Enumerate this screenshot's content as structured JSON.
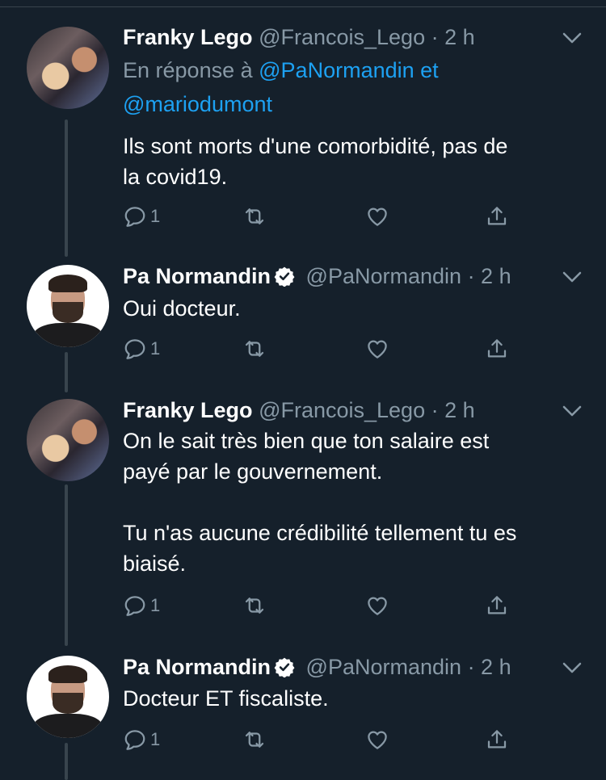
{
  "tweets": [
    {
      "name": "Franky Lego",
      "handle": "@Francois_Lego",
      "time": "· 2 h",
      "reply_prefix": "En réponse à",
      "reply_users": [
        "@PaNormandin",
        "@mariodumont"
      ],
      "reply_joiner": "et",
      "text_lines": [
        "Ils sont morts d'une comorbidité, pas de",
        "la covid19."
      ],
      "reply_count": "1",
      "verified": false,
      "avatar": "franky-lego-avatar"
    },
    {
      "name": "Pa Normandin",
      "handle": "@PaNormandin",
      "time": "· 2 h",
      "text_lines": [
        "Oui docteur."
      ],
      "reply_count": "1",
      "verified": true,
      "avatar": "pa-normandin-avatar"
    },
    {
      "name": "Franky Lego",
      "handle": "@Francois_Lego",
      "time": "· 2 h",
      "text_lines": [
        "On le sait très bien que ton salaire est",
        "payé par le gouvernement.",
        "",
        "Tu n'as aucune crédibilité tellement tu es",
        "biaisé."
      ],
      "reply_count": "1",
      "verified": false,
      "avatar": "franky-lego-avatar"
    },
    {
      "name": "Pa Normandin",
      "handle": "@PaNormandin",
      "time": "· 2 h",
      "text_lines": [
        "Docteur ET fiscaliste."
      ],
      "reply_count": "1",
      "verified": true,
      "avatar": "pa-normandin-avatar"
    }
  ],
  "icons": {
    "reply": "reply-icon",
    "retweet": "retweet-icon",
    "like": "heart-icon",
    "share": "share-icon",
    "more": "chevron-down-icon",
    "verified": "verified-badge-icon"
  },
  "colors": {
    "background": "#15202b",
    "text": "#ffffff",
    "secondary": "#8899a6",
    "link": "#1da1f2",
    "thread_line": "#38444d"
  }
}
